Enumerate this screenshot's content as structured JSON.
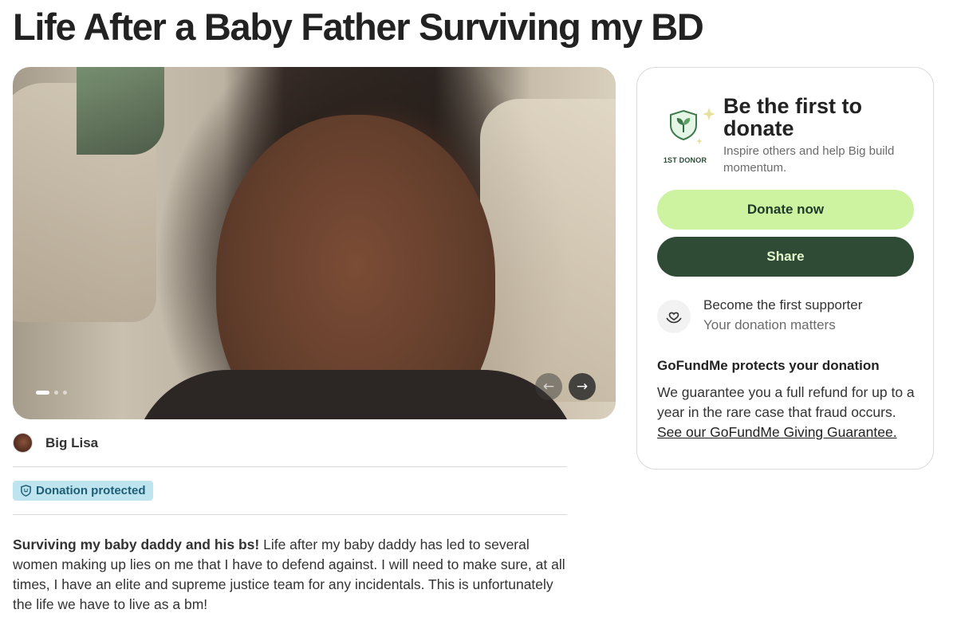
{
  "page": {
    "title": "Life After a Baby Father Surviving my BD"
  },
  "carousel": {
    "slide_count": 3,
    "active_slide": 1,
    "prev_icon": "arrow-left-icon",
    "next_icon": "arrow-right-icon"
  },
  "organizer": {
    "name": "Big Lisa"
  },
  "badge": {
    "label": "Donation protected",
    "icon": "shield-icon"
  },
  "story": {
    "lead": "Surviving my baby daddy and his bs!",
    "body": " Life after my baby daddy has led to several women making up lies on me that I have to defend against. I will need to make sure, at all times, I have an elite and supreme justice team for any incidentals. This is unfortunately the life we have to live as a bm!"
  },
  "side_card": {
    "badge_label": "1ST DONOR",
    "badge_icon": "sprout-shield-icon",
    "heading": "Be the first to donate",
    "subtext": "Inspire others and help Big build momentum.",
    "donate_label": "Donate now",
    "share_label": "Share",
    "supporter_title": "Become the first supporter",
    "supporter_subtitle": "Your donation matters",
    "supporter_icon": "heart-hand-icon",
    "protect_heading": "GoFundMe protects your donation",
    "protect_text": "We guarantee you a full refund for up to a year in the rare case that fraud occurs. ",
    "protect_link": "See our GoFundMe Giving Guarantee."
  },
  "colors": {
    "donate_button": "#cdf2a0",
    "share_button": "#2f4b36",
    "badge_background": "#bde4ef",
    "badge_text": "#1f5e75"
  }
}
